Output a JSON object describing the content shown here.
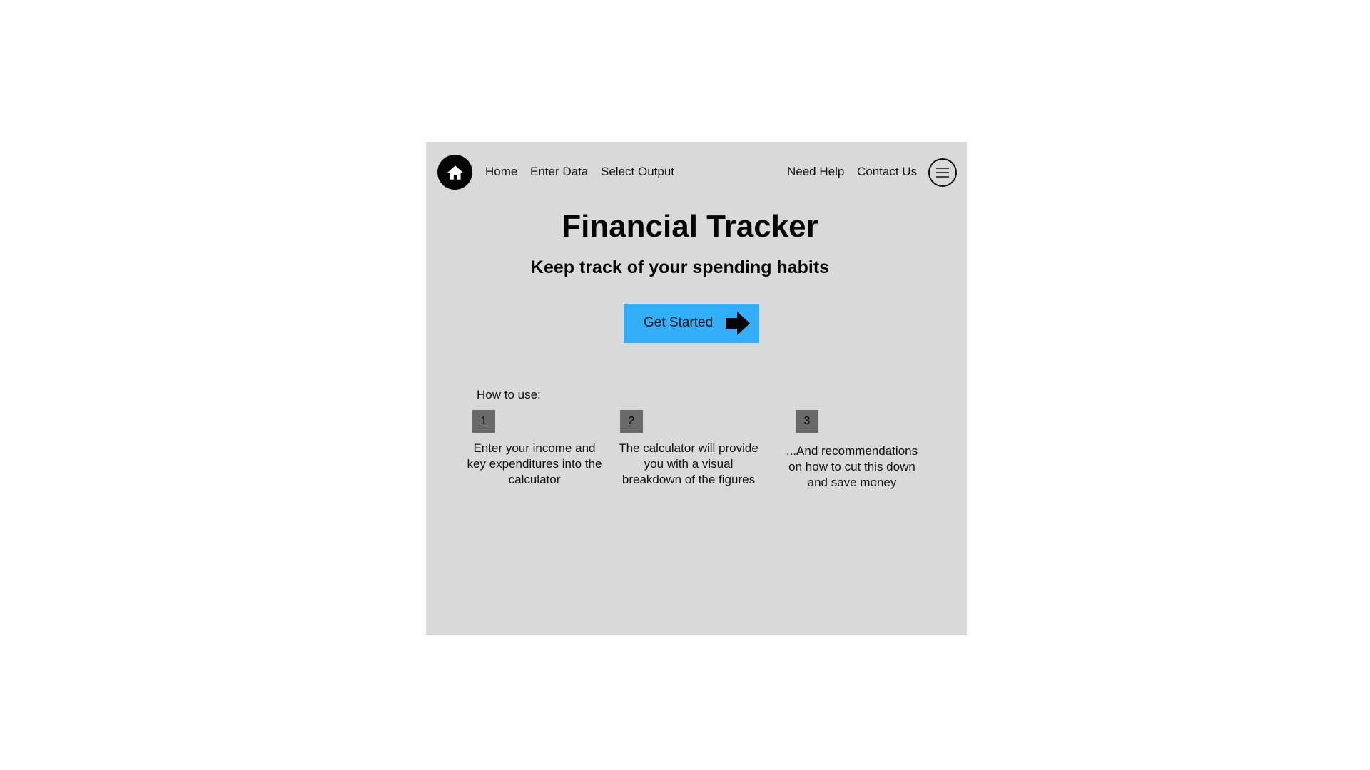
{
  "nav": {
    "home_icon": "home-icon",
    "left_links": [
      "Home",
      "Enter Data",
      "Select Output"
    ],
    "right_links": [
      "Need Help",
      "Contact Us"
    ],
    "menu_icon": "hamburger-menu-icon"
  },
  "hero": {
    "title": "Financial Tracker",
    "subtitle": "Keep track of your spending habits",
    "cta_label": "Get Started",
    "cta_icon": "arrow-right-icon",
    "cta_color": "#33aff9"
  },
  "how_to": {
    "label": "How to use:",
    "steps": [
      {
        "number": "1",
        "text": "Enter your income and key expenditures into the calculator"
      },
      {
        "number": "2",
        "text": "The calculator will provide you with a visual breakdown of the figures"
      },
      {
        "number": "3",
        "text": "...And recommendations on how to cut this down and save money"
      }
    ]
  },
  "colors": {
    "panel_background": "#d9d9d9",
    "badge_background": "#6a6a6a",
    "text": "#111111"
  }
}
